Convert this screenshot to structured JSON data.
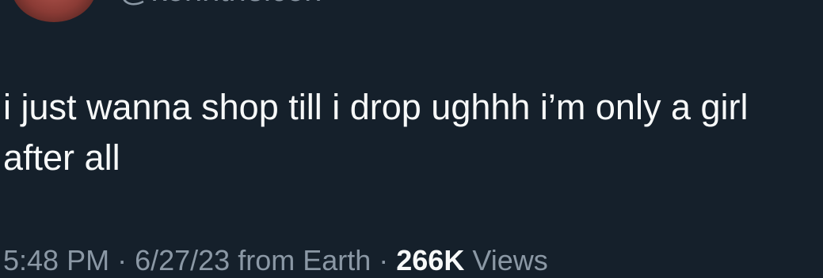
{
  "author": {
    "handle": "@kohhthelcon"
  },
  "tweet": {
    "text": "i just wanna shop till i drop ughhh i’m only a girl\nafter all"
  },
  "meta": {
    "time": "5:48 PM",
    "separator": " · ",
    "date": "6/27/23",
    "source": " from Earth",
    "views_count": "266K",
    "views_label": " Views"
  },
  "colors": {
    "background": "#15202b",
    "text_primary": "#f7f9f9",
    "text_secondary": "#8b98a5"
  }
}
